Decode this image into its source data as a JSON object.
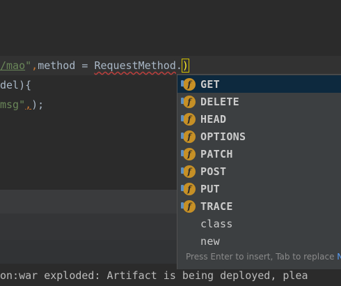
{
  "editor": {
    "line1": {
      "path_str": "/mao",
      "quote": "\"",
      "comma": ",",
      "param_name": "method",
      "op": " = ",
      "enum_class": "RequestMethod",
      "dot": ".",
      "paren": ")"
    },
    "line2": {
      "text": "del){"
    },
    "line3": {
      "str": "msg\"",
      "comma": ",",
      "tail": ");"
    }
  },
  "completion_popup": {
    "items": [
      {
        "label": "GET",
        "icon": "field-icon",
        "selected": true
      },
      {
        "label": "DELETE",
        "icon": "field-icon"
      },
      {
        "label": "HEAD",
        "icon": "field-icon"
      },
      {
        "label": "OPTIONS",
        "icon": "field-icon"
      },
      {
        "label": "PATCH",
        "icon": "field-icon"
      },
      {
        "label": "POST",
        "icon": "field-icon"
      },
      {
        "label": "PUT",
        "icon": "field-icon"
      },
      {
        "label": "TRACE",
        "icon": "field-icon"
      },
      {
        "label": "class",
        "icon": null
      },
      {
        "label": "new",
        "icon": null
      }
    ],
    "icon_glyph": "f",
    "hint": "Press Enter to insert, Tab to replace",
    "hint_link": "N"
  },
  "status": {
    "text": "on:war exploded: Artifact is being deployed, plea"
  },
  "colors": {
    "editor_bg": "#2b2b2b",
    "popup_bg": "#3c3f41",
    "selection_bg": "#0d293e",
    "string_green": "#6a8759",
    "field_badge": "#c69026"
  }
}
